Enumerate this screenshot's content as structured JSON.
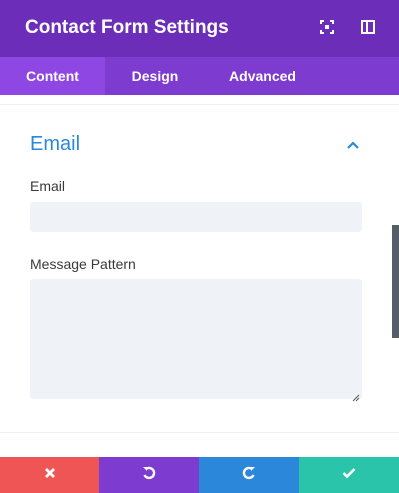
{
  "header": {
    "title": "Contact Form Settings",
    "icons": [
      "expand-icon",
      "sidebar-toggle-icon"
    ],
    "color": "#6c2eb9"
  },
  "tabs": [
    {
      "label": "Content",
      "active": true
    },
    {
      "label": "Design",
      "active": false
    },
    {
      "label": "Advanced",
      "active": false
    }
  ],
  "section": {
    "title": "Email",
    "expanded": true,
    "accent": "#2b87da"
  },
  "fields": {
    "email": {
      "label": "Email",
      "value": ""
    },
    "message_pattern": {
      "label": "Message Pattern",
      "value": ""
    }
  },
  "footer": {
    "buttons": [
      {
        "name": "cancel",
        "icon": "close-icon",
        "color": "#ef5555"
      },
      {
        "name": "undo",
        "icon": "undo-icon",
        "color": "#7e3bd0"
      },
      {
        "name": "redo",
        "icon": "redo-icon",
        "color": "#2b87da"
      },
      {
        "name": "save",
        "icon": "check-icon",
        "color": "#29c4a9"
      }
    ]
  }
}
